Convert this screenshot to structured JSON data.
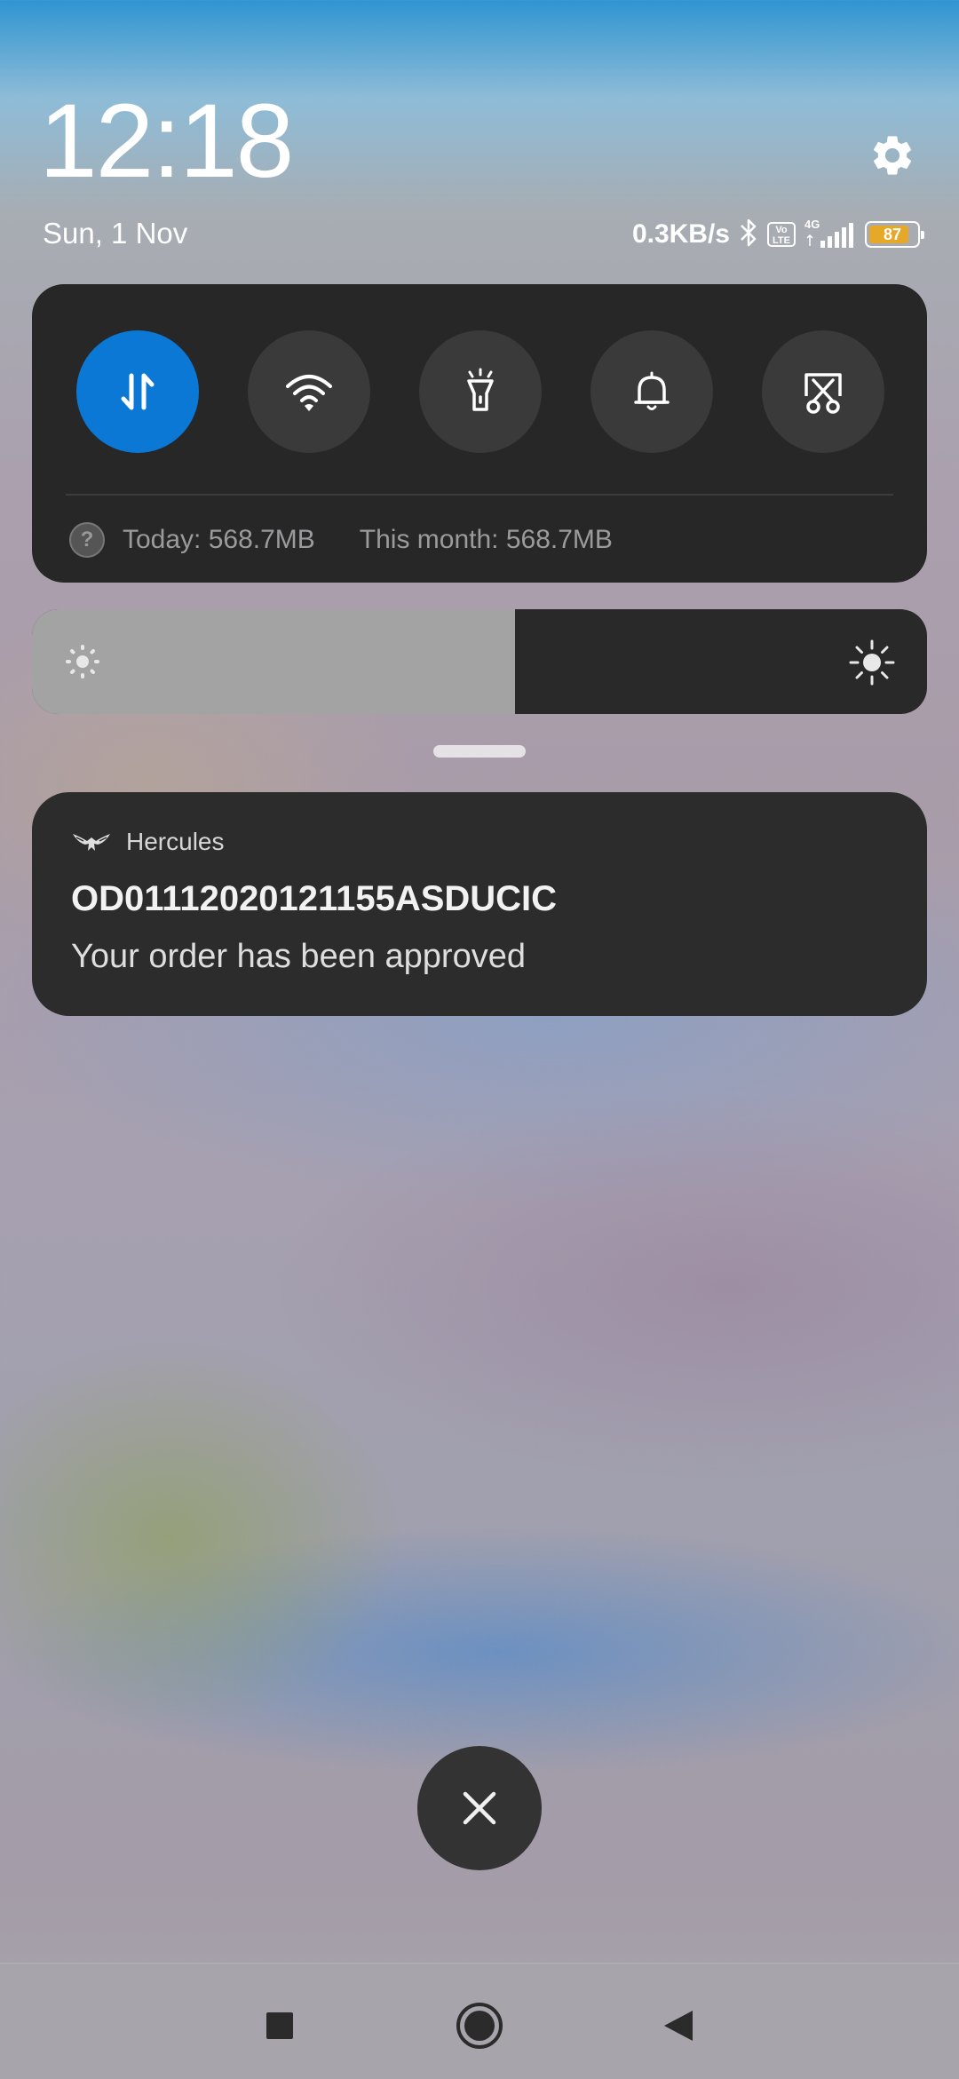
{
  "status": {
    "time": "12:18",
    "date": "Sun, 1 Nov",
    "network_speed": "0.3KB/s",
    "volte_label": "Vo LTE",
    "network_type": "4G",
    "battery_level": "87",
    "battery_color": "#e6a829"
  },
  "quick_settings": {
    "toggles": [
      {
        "name": "mobile-data",
        "icon": "data-transfer-icon",
        "active": true
      },
      {
        "name": "wifi",
        "icon": "wifi-icon",
        "active": false
      },
      {
        "name": "flashlight",
        "icon": "flashlight-icon",
        "active": false
      },
      {
        "name": "sound",
        "icon": "bell-icon",
        "active": false
      },
      {
        "name": "screenshot",
        "icon": "scissors-screenshot-icon",
        "active": false
      }
    ],
    "accent_color": "#0b78d6",
    "data_usage": {
      "today": "Today: 568.7MB",
      "this_month": "This month: 568.7MB"
    }
  },
  "brightness": {
    "level_fraction": 0.54,
    "low_icon": "sun-small-icon",
    "high_icon": "sun-large-icon"
  },
  "notification": {
    "app_name": "Hercules",
    "app_icon": "hercules-eagle-icon",
    "title": "OD01112020121155ASDUCIC",
    "text": "Your order has been approved"
  },
  "clear_button": {
    "icon": "close-icon"
  },
  "navigation": {
    "buttons": [
      "recents-square-icon",
      "home-circle-icon",
      "back-triangle-icon"
    ]
  }
}
